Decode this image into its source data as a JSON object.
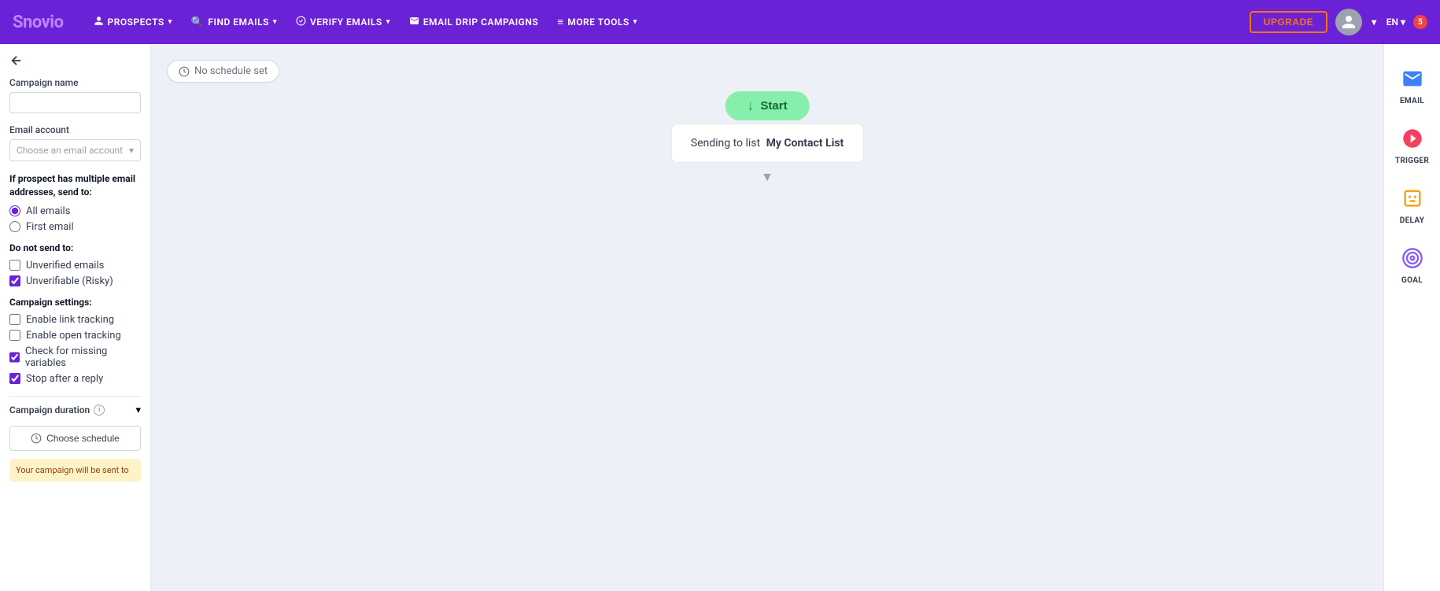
{
  "header": {
    "logo_main": "Snov",
    "logo_sub": "io",
    "nav_items": [
      {
        "id": "prospects",
        "label": "PROSPECTS",
        "icon": "👤"
      },
      {
        "id": "find_emails",
        "label": "FIND EMAILS",
        "icon": "🔍"
      },
      {
        "id": "verify_emails",
        "label": "VERIFY EMAILS",
        "icon": "✅"
      },
      {
        "id": "email_drip",
        "label": "EMAIL DRIP CAMPAIGNS",
        "icon": "✉️"
      },
      {
        "id": "more_tools",
        "label": "MORE TOOLS",
        "icon": "≡"
      }
    ],
    "upgrade_label": "UPGRADE",
    "lang": "EN",
    "notif_count": "5"
  },
  "sidebar": {
    "campaign_name_label": "Campaign name",
    "campaign_name_value": "",
    "email_account_label": "Email account",
    "email_account_placeholder": "Choose an email account",
    "multiple_email_title": "If prospect has multiple email addresses, send to:",
    "all_emails_label": "All emails",
    "first_email_label": "First email",
    "do_not_send_title": "Do not send to:",
    "unverified_label": "Unverified emails",
    "unverifiable_label": "Unverifiable (Risky)",
    "campaign_settings_title": "Campaign settings:",
    "enable_link_tracking_label": "Enable link tracking",
    "enable_open_tracking_label": "Enable open tracking",
    "check_missing_variables_label": "Check for missing variables",
    "stop_after_reply_label": "Stop after a reply",
    "campaign_duration_label": "Campaign duration",
    "choose_schedule_label": "Choose schedule",
    "campaign_will_send_text": "Your campaign will be sent to"
  },
  "canvas": {
    "schedule_badge": "No schedule set",
    "start_label": "Start",
    "sending_to_text": "Sending to list",
    "list_name": "My Contact List"
  },
  "right_tools": [
    {
      "id": "email",
      "label": "EMAIL"
    },
    {
      "id": "trigger",
      "label": "TRIGGER"
    },
    {
      "id": "delay",
      "label": "DELAY"
    },
    {
      "id": "goal",
      "label": "GOAL"
    }
  ]
}
